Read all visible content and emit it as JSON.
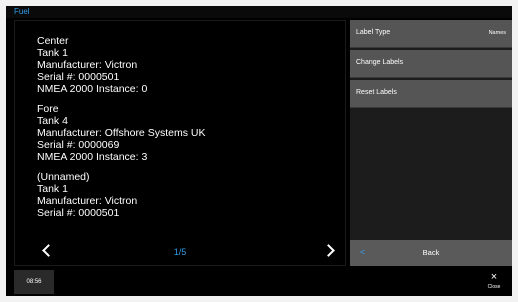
{
  "window": {
    "title": "Fuel"
  },
  "entries": [
    {
      "lines": [
        "Center",
        "Tank 1",
        "Manufacturer: Victron",
        "Serial #: 0000501",
        "NMEA 2000 Instance: 0"
      ]
    },
    {
      "lines": [
        "Fore",
        "Tank 4",
        "Manufacturer: Offshore Systems UK",
        "Serial #: 0000069",
        "NMEA 2000 Instance: 3"
      ]
    },
    {
      "lines": [
        "(Unnamed)",
        "Tank 1",
        "Manufacturer: Victron",
        "Serial #: 0000501"
      ]
    }
  ],
  "pager": {
    "text": "1/5",
    "prev_icon": "chevron-left-icon",
    "next_icon": "chevron-right-icon"
  },
  "menu": {
    "label_type": {
      "label": "Label Type",
      "value": "Names"
    },
    "change_labels": "Change Labels",
    "reset_labels": "Reset Labels",
    "back": {
      "label": "Back",
      "icon": "chevron-left-icon"
    }
  },
  "footer": {
    "time": "08:56",
    "close_label": "Close",
    "close_icon": "×"
  },
  "colors": {
    "accent": "#2f9de6",
    "button": "#555555",
    "background": "#000000"
  }
}
